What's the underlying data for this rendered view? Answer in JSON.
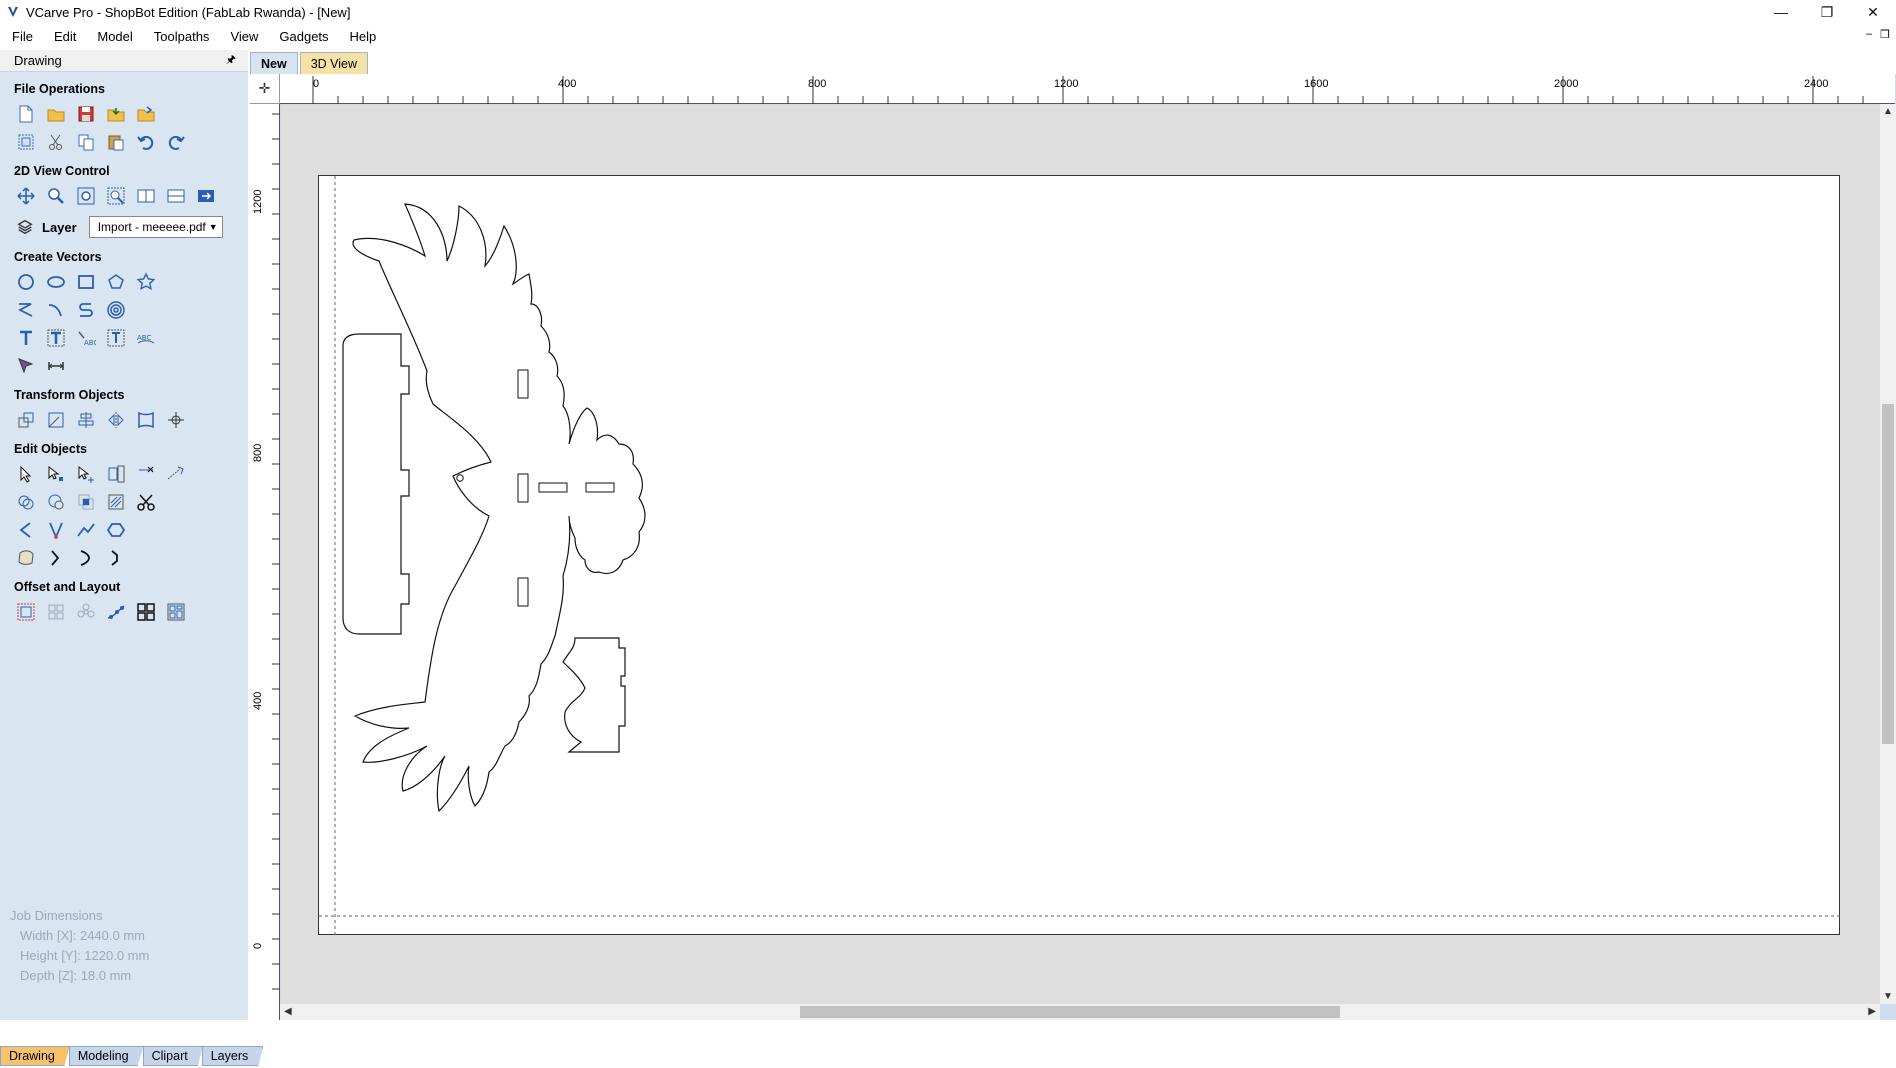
{
  "window": {
    "title": "VCarve Pro - ShopBot Edition (FabLab Rwanda) - [New]",
    "min_glyph": "—",
    "restore_glyph": "❐",
    "close_glyph": "✕"
  },
  "menubar": {
    "items": [
      "File",
      "Edit",
      "Model",
      "Toolpaths",
      "View",
      "Gadgets",
      "Help"
    ],
    "mdi_min": "–",
    "mdi_restore": "❐"
  },
  "panel": {
    "header": "Drawing",
    "pin_glyph": "🖈",
    "sections": {
      "file_ops": "File Operations",
      "view_control": "2D View Control",
      "create_vectors": "Create Vectors",
      "transform": "Transform Objects",
      "edit_objects": "Edit Objects",
      "offset_layout": "Offset and Layout"
    },
    "layer": {
      "label": "Layer",
      "value": "Import - meeeee.pdf",
      "arrow": "▼"
    },
    "job_dimensions": {
      "title": "Job Dimensions",
      "width": "Width  [X]: 2440.0 mm",
      "height": "Height [Y]: 1220.0 mm",
      "depth": "Depth  [Z]: 18.0 mm"
    },
    "bottom_tabs": [
      "Drawing",
      "Modeling",
      "Clipart",
      "Layers"
    ]
  },
  "doc_tabs": [
    "New",
    "3D View"
  ],
  "ruler": {
    "top_labels": [
      "0",
      "400",
      "800",
      "1200",
      "1600",
      "2000",
      "2400"
    ],
    "left_labels": [
      "1200",
      "800",
      "400",
      "0"
    ],
    "corner_glyph": "✛"
  },
  "colors": {
    "panel_bg": "#dae5f2",
    "active_tab": "#f6c36a",
    "view3d_tab": "#f7e2a6",
    "canvas_bg": "#dedede"
  }
}
